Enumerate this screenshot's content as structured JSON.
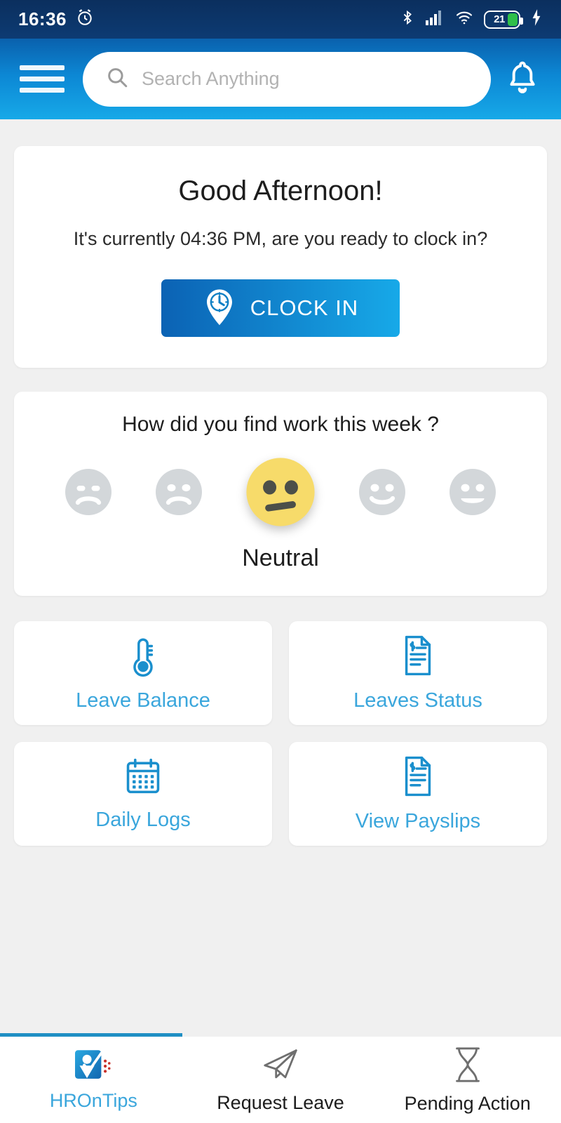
{
  "status_bar": {
    "time": "16:36",
    "alarm_icon": "alarm-icon",
    "bluetooth_icon": "bluetooth-icon",
    "signal_icon": "cellular-signal-icon",
    "wifi_icon": "wifi-icon",
    "battery_level": "21",
    "charging_icon": "charging-bolt-icon"
  },
  "header": {
    "menu_icon": "hamburger-menu-icon",
    "search_placeholder": "Search Anything",
    "search_value": "",
    "search_icon": "search-icon",
    "notification_icon": "bell-icon",
    "gradient_start": "#0a61ad",
    "gradient_end": "#17a9e8"
  },
  "greeting": {
    "title": "Good Afternoon!",
    "subtitle": "It's currently 04:36 PM, are you ready to clock in?",
    "clock_in_label": "CLOCK IN",
    "clock_in_icon": "clock-pin-icon",
    "button_gradient_start": "#0b62b4",
    "button_gradient_end": "#17a9e8"
  },
  "mood": {
    "question": "How did you find work this week ?",
    "selected_label": "Neutral",
    "selected_index": 2,
    "selected_color": "#f7db6a",
    "inactive_color": "#d3d7da",
    "faces": [
      {
        "name": "very-sad-face",
        "expression": "sad"
      },
      {
        "name": "sad-face",
        "expression": "sad"
      },
      {
        "name": "neutral-face",
        "expression": "neutral"
      },
      {
        "name": "happy-face",
        "expression": "smile"
      },
      {
        "name": "very-happy-face",
        "expression": "grin"
      }
    ]
  },
  "tiles": [
    {
      "label": "Leave Balance",
      "icon": "thermometer-icon"
    },
    {
      "label": "Leaves Status",
      "icon": "document-dollar-icon"
    },
    {
      "label": "Daily Logs",
      "icon": "calendar-icon"
    },
    {
      "label": "View Payslips",
      "icon": "document-dollar-icon"
    }
  ],
  "tile_label_color": "#3aa6dc",
  "bottom_nav": {
    "active_index": 0,
    "active_color": "#3aa6dc",
    "items": [
      {
        "label": "HROnTips",
        "icon": "hrontips-logo-icon"
      },
      {
        "label": "Request Leave",
        "icon": "paper-plane-icon"
      },
      {
        "label": "Pending Action",
        "icon": "hourglass-icon"
      }
    ]
  }
}
